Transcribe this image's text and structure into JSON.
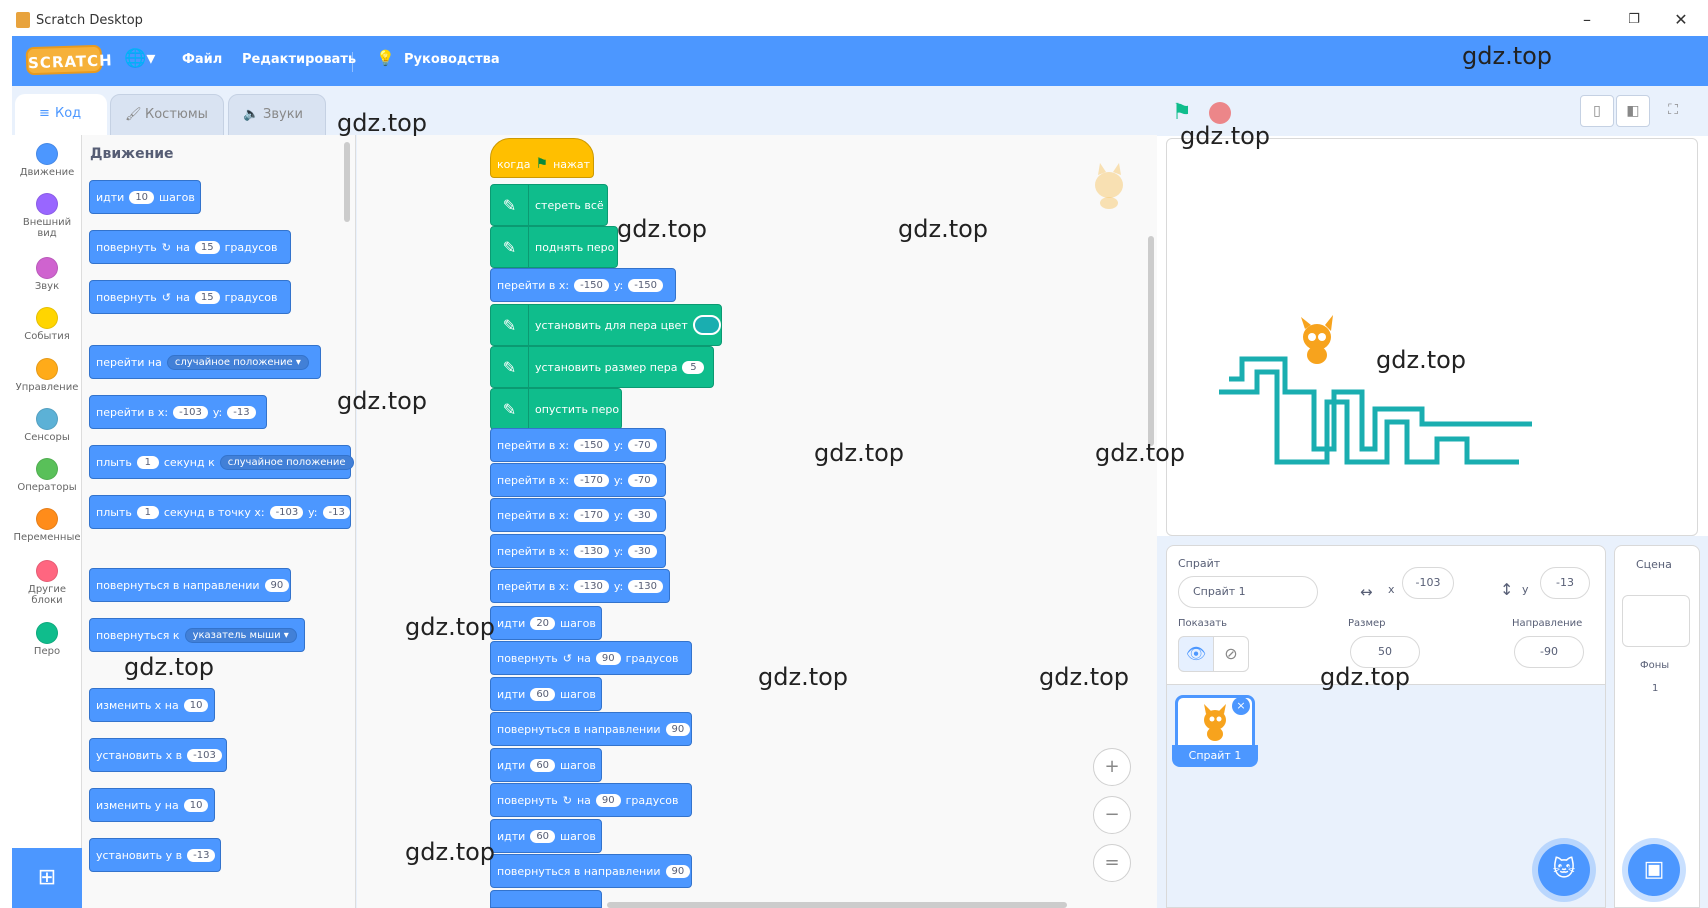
{
  "window": {
    "title": "Scratch Desktop",
    "minimize_icon": "–",
    "restore_icon": "❐",
    "close_icon": "✕"
  },
  "menubar": {
    "logo": "SCRATCH",
    "globe_icon": "🌐▾",
    "file": "Файл",
    "edit": "Редактировать",
    "tutorials_icon": "💡",
    "tutorials": "Руководства"
  },
  "tabs": {
    "code": "Код",
    "costumes": "Костюмы",
    "sounds": "Звуки"
  },
  "categories": [
    {
      "label": "Движение",
      "color": "#4c97ff"
    },
    {
      "label": "Внешний вид",
      "color": "#9966ff"
    },
    {
      "label": "Звук",
      "color": "#cf63cf"
    },
    {
      "label": "События",
      "color": "#ffd500"
    },
    {
      "label": "Управление",
      "color": "#ffab19"
    },
    {
      "label": "Сенсоры",
      "color": "#5cb1d6"
    },
    {
      "label": "Операторы",
      "color": "#59c059"
    },
    {
      "label": "Переменные",
      "color": "#ff8c1a"
    },
    {
      "label": "Другие блоки",
      "color": "#ff6680"
    },
    {
      "label": "Перо",
      "color": "#0fbd8c"
    }
  ],
  "palette": {
    "title": "Движение",
    "b1": {
      "a": "идти",
      "v": "10",
      "b": "шагов"
    },
    "b2": {
      "a": "повернуть",
      "icon": "↻",
      "b": "на",
      "v": "15",
      "c": "градусов"
    },
    "b3": {
      "a": "повернуть",
      "icon": "↺",
      "b": "на",
      "v": "15",
      "c": "градусов"
    },
    "b4": {
      "a": "перейти на",
      "dd": "случайное положение ▾"
    },
    "b5": {
      "a": "перейти в x:",
      "x": "-103",
      "b": "y:",
      "y": "-13"
    },
    "b6": {
      "a": "плыть",
      "v": "1",
      "b": "секунд к",
      "dd": "случайное положение"
    },
    "b7": {
      "a": "плыть",
      "v": "1",
      "b": "секунд в точку x:",
      "x": "-103",
      "c": "y:",
      "y": "-13"
    },
    "b8": {
      "a": "повернуться в направлении",
      "v": "90"
    },
    "b9": {
      "a": "повернуться к",
      "dd": "указатель мыши ▾"
    },
    "b10": {
      "a": "изменить х на",
      "v": "10"
    },
    "b11": {
      "a": "установить х в",
      "v": "-103"
    },
    "b12": {
      "a": "изменить у на",
      "v": "10"
    },
    "b13": {
      "a": "установить у в",
      "v": "-13"
    }
  },
  "script": {
    "hat": {
      "a": "когда",
      "flag": "⚑",
      "b": "нажат"
    },
    "s1": "стереть всё",
    "s2": "поднять перо",
    "s3": {
      "a": "перейти в x:",
      "x": "-150",
      "b": "y:",
      "y": "-150"
    },
    "s4": "установить для пера цвет",
    "s5": {
      "a": "установить размер пера",
      "v": "5"
    },
    "s6": "опустить перо",
    "goto_label": "перейти в x:",
    "y_label": "y:",
    "gotos": [
      {
        "x": "-150",
        "y": "-70"
      },
      {
        "x": "-170",
        "y": "-70"
      },
      {
        "x": "-170",
        "y": "-30"
      },
      {
        "x": "-130",
        "y": "-30"
      },
      {
        "x": "-130",
        "y": "-130"
      }
    ],
    "m1": {
      "a": "идти",
      "v": "20",
      "b": "шагов"
    },
    "t1": {
      "a": "повернуть",
      "icon": "↺",
      "b": "на",
      "v": "90",
      "c": "градусов"
    },
    "m2": {
      "a": "идти",
      "v": "60",
      "b": "шагов"
    },
    "d1": {
      "a": "повернуться в направлении",
      "v": "90"
    },
    "m3": {
      "a": "идти",
      "v": "60",
      "b": "шагов"
    },
    "t2": {
      "a": "повернуть",
      "icon": "↻",
      "b": "на",
      "v": "90",
      "c": "градусов"
    },
    "m4": {
      "a": "идти",
      "v": "60",
      "b": "шагов"
    },
    "d2": {
      "a": "повернуться в направлении",
      "v": "90"
    }
  },
  "zoom": {
    "in": "+",
    "out": "−",
    "reset": "="
  },
  "stage_controls": {
    "flag": "⚑",
    "small": "▯",
    "normal": "◧",
    "full": "⛶"
  },
  "sprite": {
    "label": "Спрайт",
    "name": "Спрайт 1",
    "x_label": "x",
    "x": "-103",
    "y_label": "y",
    "y": "-13",
    "show_label": "Показать",
    "size_label": "Размер",
    "size": "50",
    "direction_label": "Направление",
    "direction": "-90",
    "eye_on": "👁",
    "eye_off": "⊘",
    "thumb_label": "Спрайт 1",
    "delete": "×",
    "arrows_x": "↔",
    "arrows_y": "↕"
  },
  "stage_panel": {
    "title": "Сцена",
    "backdrops_label": "Фоны",
    "backdrops_count": "1"
  },
  "watermark": "gdz.top",
  "colors": {
    "motion": "#4c97ff",
    "pen": "#0fbd8c",
    "events": "#ffbf00",
    "menubar": "#4c97ff",
    "drawing": "#1aaeb0"
  }
}
